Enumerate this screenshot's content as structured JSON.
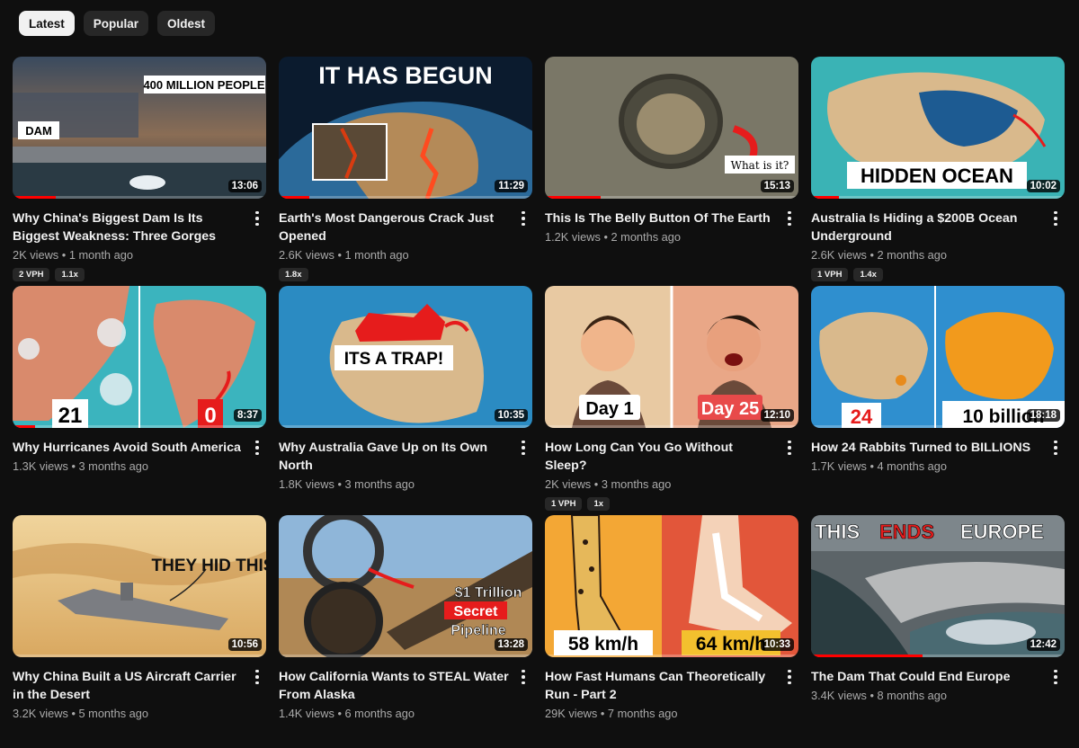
{
  "filters": {
    "chips": [
      {
        "label": "Latest",
        "active": true
      },
      {
        "label": "Popular",
        "active": false
      },
      {
        "label": "Oldest",
        "active": false
      }
    ]
  },
  "videos": [
    {
      "title": "Why China's Biggest Dam Is Its Biggest Weakness: Three Gorges Dam",
      "views": "2K views",
      "age": "1 month ago",
      "duration": "13:06",
      "badges": [
        "2 VPH",
        "1.1x"
      ],
      "overlay": [
        "400 MILLION PEOPLE",
        "DAM"
      ]
    },
    {
      "title": "Earth's Most Dangerous Crack Just Opened",
      "views": "2.6K views",
      "age": "1 month ago",
      "duration": "11:29",
      "badges": [
        "1.8x"
      ],
      "overlay": [
        "IT HAS BEGUN"
      ]
    },
    {
      "title": "This Is The Belly Button Of The Earth",
      "views": "1.2K views",
      "age": "2 months ago",
      "duration": "15:13",
      "badges": [],
      "overlay": [
        "What is it?"
      ]
    },
    {
      "title": "Australia Is Hiding a $200B Ocean Underground",
      "views": "2.6K views",
      "age": "2 months ago",
      "duration": "10:02",
      "badges": [
        "1 VPH",
        "1.4x"
      ],
      "overlay": [
        "HIDDEN OCEAN"
      ]
    },
    {
      "title": "Why Hurricanes Avoid South America",
      "views": "1.3K views",
      "age": "3 months ago",
      "duration": "8:37",
      "badges": [],
      "overlay": [
        "21",
        "0"
      ]
    },
    {
      "title": "Why Australia Gave Up on Its Own North",
      "views": "1.8K views",
      "age": "3 months ago",
      "duration": "10:35",
      "badges": [],
      "overlay": [
        "ITS A TRAP!"
      ]
    },
    {
      "title": "How Long Can You Go Without Sleep?",
      "views": "2K views",
      "age": "3 months ago",
      "duration": "12:10",
      "badges": [
        "1 VPH",
        "1x"
      ],
      "overlay": [
        "Day 1",
        "Day 25"
      ]
    },
    {
      "title": "How 24 Rabbits Turned to BILLIONS",
      "views": "1.7K views",
      "age": "4 months ago",
      "duration": "18:18",
      "badges": [],
      "overlay": [
        "24",
        "10 billion"
      ]
    },
    {
      "title": "Why China Built a US Aircraft Carrier in the Desert",
      "views": "3.2K views",
      "age": "5 months ago",
      "duration": "10:56",
      "badges": [],
      "overlay": [
        "THEY HID THIS"
      ]
    },
    {
      "title": "How California Wants to STEAL Water From Alaska",
      "views": "1.4K views",
      "age": "6 months ago",
      "duration": "13:28",
      "badges": [],
      "overlay": [
        "$1 Trillion",
        "Secret",
        "Pipeline"
      ]
    },
    {
      "title": "How Fast Humans Can Theoretically Run - Part 2",
      "views": "29K views",
      "age": "7 months ago",
      "duration": "10:33",
      "badges": [],
      "overlay": [
        "58 km/h",
        "64 km/h"
      ]
    },
    {
      "title": "The Dam That Could End Europe",
      "views": "3.4K views",
      "age": "8 months ago",
      "duration": "12:42",
      "badges": [],
      "overlay": [
        "THIS",
        "ENDS",
        "EUROPE"
      ]
    }
  ],
  "colors": {
    "background": "#0f0f0f",
    "chip": "#272727",
    "chip_active": "#f1f1f1",
    "progress": "#ff0000",
    "meta": "#aaaaaa"
  }
}
